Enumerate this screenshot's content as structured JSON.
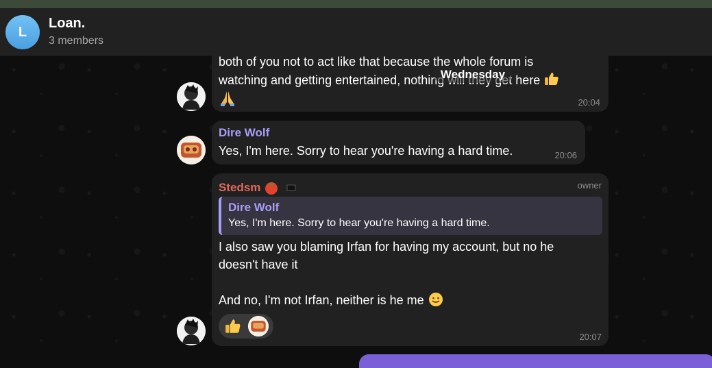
{
  "header": {
    "avatar_letter": "L",
    "title": "Loan.",
    "subtitle": "3 members"
  },
  "date_divider": "Wednesday",
  "messages": [
    {
      "text_line1": "both of you not to act like that because the whole forum is",
      "text_line2": "watching and getting entertained, nothing will they get here",
      "time": "20:04"
    },
    {
      "sender": "Dire Wolf",
      "text": "Yes, I'm here.  Sorry to hear you're having a hard time.",
      "time": "20:06"
    },
    {
      "sender": "Stedsm",
      "role": "owner",
      "reply": {
        "sender": "Dire Wolf",
        "text": "Yes, I'm here. Sorry to hear you're having a hard time."
      },
      "text_line1": "I also saw you blaming Irfan for having my account, but no he",
      "text_line2": "doesn't have it",
      "text_line3": "And no, I'm not Irfan, neither is he me",
      "reactions": [
        "thumbs-up",
        "dire-wolf-avatar"
      ],
      "time": "20:07"
    }
  ],
  "colors": {
    "accent_purple": "#a99ef7",
    "sender_red": "#e2685e",
    "own_bubble": "#7a5fd6"
  }
}
